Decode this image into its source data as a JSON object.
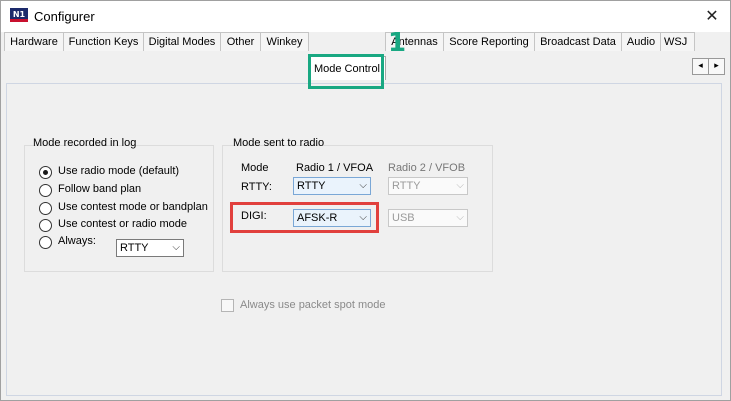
{
  "window": {
    "title": "Configurer",
    "icon_text": "N1",
    "close_label": "✕"
  },
  "tabs": [
    {
      "label": "Hardware",
      "active": false
    },
    {
      "label": "Function Keys",
      "active": false
    },
    {
      "label": "Digital Modes",
      "active": false
    },
    {
      "label": "Other",
      "active": false
    },
    {
      "label": "Winkey",
      "active": false
    },
    {
      "label": "Mode Control",
      "active": true
    },
    {
      "label": "Antennas",
      "active": false
    },
    {
      "label": "Score Reporting",
      "active": false
    },
    {
      "label": "Broadcast Data",
      "active": false
    },
    {
      "label": "Audio",
      "active": false
    },
    {
      "label": "WSJ",
      "active": false
    }
  ],
  "tab_scroll": {
    "left": "◂",
    "right": "▸"
  },
  "callout": {
    "number": "1",
    "color": "#19a882"
  },
  "mode_log": {
    "label": "Mode recorded in log",
    "options": [
      {
        "label": "Use radio mode (default)",
        "checked": true
      },
      {
        "label": "Follow band plan",
        "checked": false
      },
      {
        "label": "Use contest mode or bandplan",
        "checked": false
      },
      {
        "label": "Use contest or radio mode",
        "checked": false
      },
      {
        "label": "Always:",
        "checked": false
      }
    ],
    "always_value": "RTTY"
  },
  "mode_radio": {
    "label": "Mode sent to radio",
    "col_mode": "Mode",
    "col_radio1": "Radio 1 / VFOA",
    "col_radio2": "Radio 2 / VFOB",
    "rows": [
      {
        "mode": "RTTY:",
        "radio1": "RTTY",
        "radio2": "RTTY"
      },
      {
        "mode": "DIGI:",
        "radio1": "AFSK-R",
        "radio2": "USB"
      }
    ],
    "highlight_color": "#e1403d"
  },
  "packet_spot": {
    "label": "Always use packet spot mode",
    "checked": false
  },
  "arrow": "⌵"
}
